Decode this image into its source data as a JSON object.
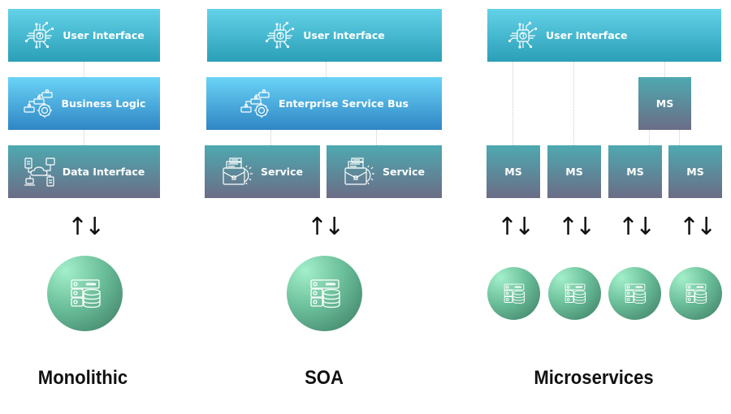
{
  "monolithic": {
    "title": "Monolithic",
    "layers": [
      {
        "label": "User Interface",
        "icon": "chip-brain-icon"
      },
      {
        "label": "Business Logic",
        "icon": "process-gear-icon"
      },
      {
        "label": "Data Interface",
        "icon": "network-cloud-icon"
      }
    ],
    "arrow": "↑↓",
    "database_icon": "server-database-icon"
  },
  "soa": {
    "title": "SOA",
    "layers": [
      {
        "label": "User Interface",
        "icon": "chip-brain-icon"
      },
      {
        "label": "Enterprise Service Bus",
        "icon": "process-gear-icon"
      }
    ],
    "services": [
      {
        "label": "Service",
        "icon": "briefcase-gear-icon"
      },
      {
        "label": "Service",
        "icon": "briefcase-gear-icon"
      }
    ],
    "arrow": "↑↓",
    "database_icon": "server-database-icon"
  },
  "microservices": {
    "title": "Microservices",
    "ui": {
      "label": "User Interface",
      "icon": "chip-brain-icon"
    },
    "middle_service": "MS",
    "services": [
      "MS",
      "MS",
      "MS",
      "MS"
    ],
    "arrows": [
      "↑↓",
      "↑↓",
      "↑↓",
      "↑↓"
    ],
    "database_icon": "server-database-icon"
  },
  "colors": {
    "ui_top": "#63d2e8",
    "ui_bottom": "#2a9fb7",
    "logic_top": "#6ad3f7",
    "logic_bottom": "#2f86c4",
    "data_top": "#4ea9b0",
    "data_bottom": "#6b6d86",
    "db_light": "#a3efcb",
    "db_dark": "#3b7a62"
  }
}
